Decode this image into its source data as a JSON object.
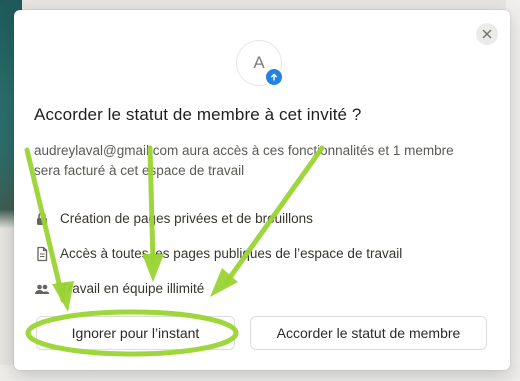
{
  "dialog": {
    "avatar_letter": "A",
    "title": "Accorder le statut de membre à cet invité ?",
    "description": "audreylaval@gmail.com aura accès à ces fonctionnalités et 1 membre sera facturé à cet espace de travail",
    "features": [
      {
        "icon": "lock-icon",
        "label": "Création de pages privées et de brouillons"
      },
      {
        "icon": "document-icon",
        "label": "Accès à toutes les pages publiques de l’espace de travail"
      },
      {
        "icon": "people-icon",
        "label": "Travail en équipe illimité"
      }
    ],
    "ignore_label": "Ignorer pour l’instant",
    "grant_label": "Accorder le statut de membre"
  },
  "colors": {
    "accent_badge": "#2383e2",
    "annotation_green": "#9ad433"
  }
}
